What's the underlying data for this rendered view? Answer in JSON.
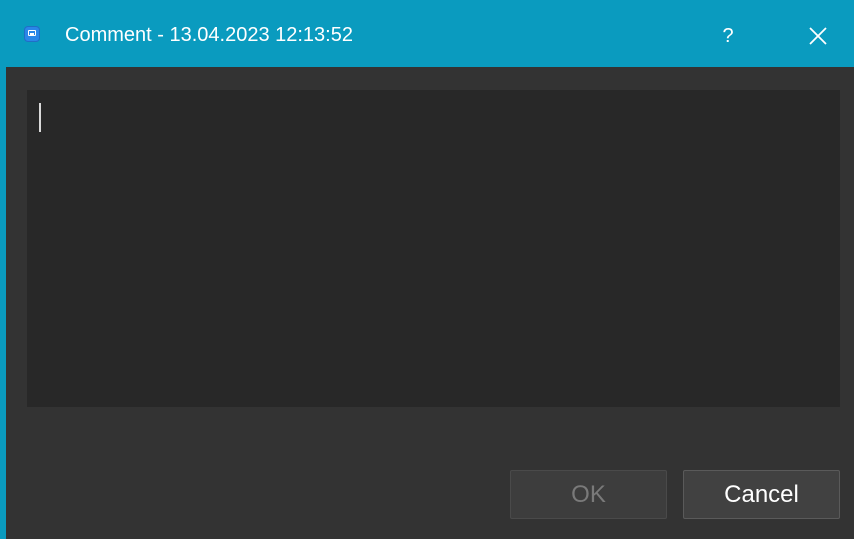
{
  "window": {
    "title": "Comment - 13.04.2023 12:13:52",
    "help_label": "?",
    "icons": {
      "app": "comment-app-icon",
      "close": "close-icon"
    },
    "accent_color": "#0a9bbf",
    "background_color": "#333333"
  },
  "editor": {
    "value": "",
    "placeholder": "",
    "background_color": "#282828"
  },
  "buttons": {
    "ok_label": "OK",
    "ok_enabled": false,
    "cancel_label": "Cancel"
  }
}
